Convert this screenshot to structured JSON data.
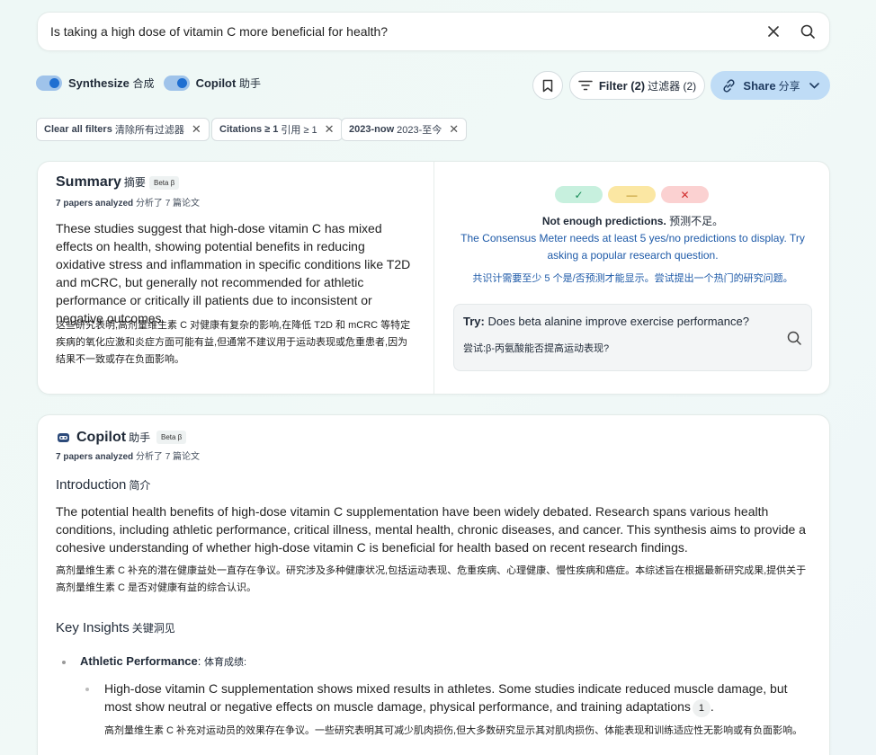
{
  "search": {
    "query": "Is taking a high dose of vitamin C more beneficial for health?"
  },
  "toolbar": {
    "synthesize_label": "Synthesize",
    "synthesize_zh": "合成",
    "copilot_label": "Copilot",
    "copilot_zh": "助手",
    "filter_label": "Filter (2)",
    "filter_zh": "过滤器 (2)",
    "share_label": "Share",
    "share_zh": "分享"
  },
  "chips": [
    {
      "label": "Clear all filters",
      "zh": "清除所有过滤器"
    },
    {
      "label": "Citations ≥ 1",
      "zh": "引用 ≥ 1"
    },
    {
      "label": "2023-now",
      "zh": "2023-至今"
    }
  ],
  "summary": {
    "title": "Summary",
    "title_zh": "摘要",
    "beta": "Beta β",
    "meta_en": "7 papers analyzed",
    "meta_zh": "分析了 7 篇论文",
    "text_en": "These studies suggest that high-dose vitamin C has mixed effects on health, showing potential benefits in reducing oxidative stress and inflammation in specific conditions like T2D and mCRC, but generally not recommended for athletic performance or critically ill patients due to inconsistent or negative outcomes.",
    "text_zh": "这些研究表明,高剂量维生素 C 对健康有复杂的影响,在降低 T2D 和 mCRC 等特定疾病的氧化应激和炎症方面可能有益,但通常不建议用于运动表现或危重患者,因为结果不一致或存在负面影响。"
  },
  "meter": {
    "yes_glyph": "✓",
    "mid_glyph": "—",
    "no_glyph": "✕",
    "headline": "Not enough predictions.",
    "headline_zh": "预测不足。",
    "desc_en": "The Consensus Meter needs at least 5 yes/no predictions to display. Try asking a popular research question.",
    "desc_zh": "共识计需要至少 5 个是/否预测才能显示。尝试提出一个热门的研究问题。",
    "try_prefix": "Try:",
    "try_question": "Does beta alanine improve exercise performance?",
    "try_zh": "尝试:β-丙氨酸能否提高运动表现?",
    "accent": "#1e5aa8"
  },
  "copilot": {
    "title": "Copilot",
    "title_zh": "助手",
    "beta": "Beta β",
    "meta_en": "7 papers analyzed",
    "meta_zh": "分析了 7 篇论文",
    "intro_heading": "Introduction",
    "intro_heading_zh": "简介",
    "intro_en": "The potential health benefits of high-dose vitamin C supplementation have been widely debated. Research spans various health conditions, including athletic performance, critical illness, mental health, chronic diseases, and cancer. This synthesis aims to provide a cohesive understanding of whether high-dose vitamin C is beneficial for health based on recent research findings.",
    "intro_zh": "高剂量维生素 C 补充的潜在健康益处一直存在争议。研究涉及多种健康状况,包括运动表现、危重疾病、心理健康、慢性疾病和癌症。本综述旨在根据最新研究成果,提供关于高剂量维生素 C 是否对健康有益的综合认识。",
    "insights_heading": "Key Insights",
    "insights_heading_zh": "关键洞见",
    "insight1_label": "Athletic Performance",
    "insight1_zh": "体育成绩:",
    "insight1_sub_en": "High-dose vitamin C supplementation shows mixed results in athletes. Some studies indicate reduced muscle damage, but most show neutral or negative effects on muscle damage, physical performance, and training adaptations",
    "insight1_cite": "1",
    "insight1_sub_zh": "高剂量维生素 C 补充对运动员的效果存在争议。一些研究表明其可减少肌肉损伤,但大多数研究显示其对肌肉损伤、体能表现和训练适应性无影响或有负面影响。"
  }
}
